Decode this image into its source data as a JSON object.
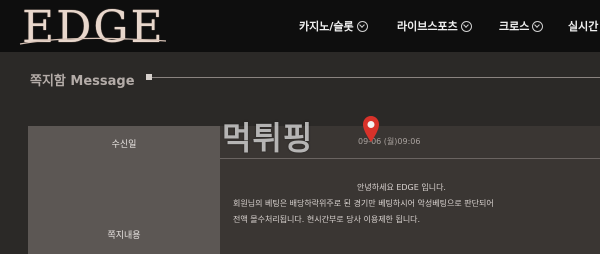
{
  "header": {
    "logo_text": "EDGE",
    "nav": [
      {
        "label": "카지노/슬롯"
      },
      {
        "label": "라이브스포츠"
      },
      {
        "label": "크로스"
      },
      {
        "label": "실시간"
      }
    ]
  },
  "page": {
    "title": "쪽지함 Message"
  },
  "table": {
    "received_label": "수신일",
    "received_value": "09-06 (월)09:06",
    "content_label": "쪽지내용",
    "message_lines": [
      "안녕하세요 EDGE 입니다.",
      "회원님의 베팅은 배당하락위주로 된 경기만 베팅하시어 악성베팅으로 판단되어",
      "전액 몰수처리됩니다. 현시간부로 당사 이용제한 됩니다."
    ]
  },
  "watermark": {
    "text": "먹튀핑"
  },
  "colors": {
    "header_bg": "#0e0e0e",
    "page_bg": "#2b2927",
    "label_bg": "#5c5754",
    "value_bg": "#3a3633",
    "logo": "#e8d7cc",
    "pin": "#d8322a"
  }
}
